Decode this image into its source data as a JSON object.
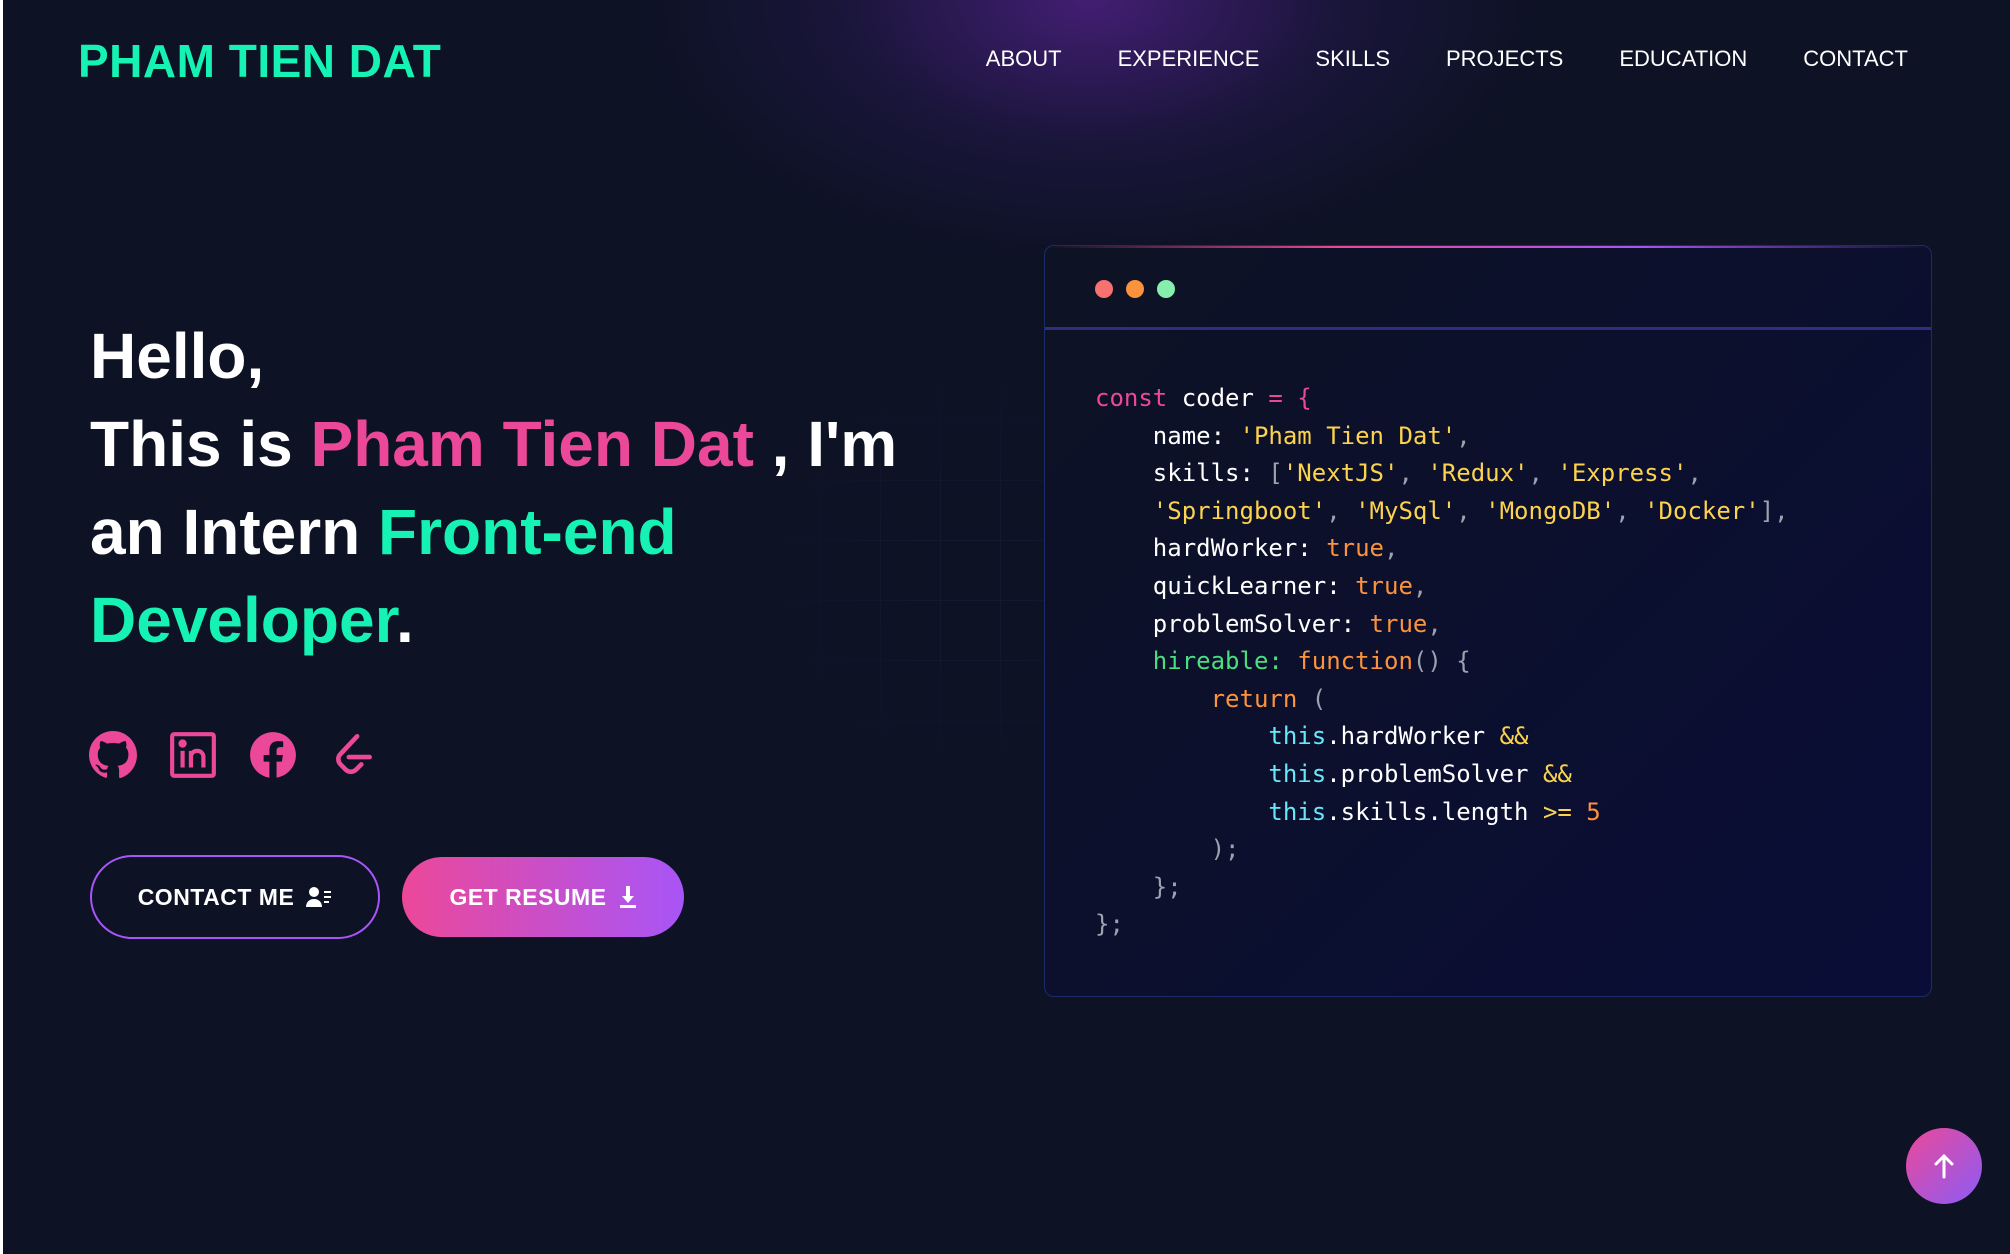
{
  "header": {
    "logo": "PHAM TIEN DAT",
    "nav": [
      "ABOUT",
      "EXPERIENCE",
      "SKILLS",
      "PROJECTS",
      "EDUCATION",
      "CONTACT"
    ]
  },
  "hero": {
    "line1": "Hello,",
    "this_is": "This is ",
    "name": "Pham Tien Dat",
    "im": " , I'm",
    "an_intern": "an Intern ",
    "role1": "Front-end",
    "role2": "Developer",
    "period": "."
  },
  "socials": [
    "github-icon",
    "linkedin-icon",
    "facebook-icon",
    "leetcode-icon"
  ],
  "buttons": {
    "contact": "CONTACT ME",
    "resume": "GET RESUME"
  },
  "code": {
    "l1_kw": "const",
    "l1_var": " coder ",
    "l1_op": "= {",
    "name_key": "name: ",
    "name_val": "'Pham Tien Dat'",
    "skills_key": "skills: ",
    "skills_1": "'NextJS'",
    "skills_2": "'Redux'",
    "skills_3": "'Express'",
    "skills_4": "'Springboot'",
    "skills_5": "'MySql'",
    "skills_6": "'MongoDB'",
    "skills_7": "'Docker'",
    "hw_key": "hardWorker: ",
    "ql_key": "quickLearner: ",
    "ps_key": "problemSolver: ",
    "true_val": "true",
    "hire_key": "hireable: ",
    "hire_fn": "function",
    "hire_rest": "() {",
    "ret_kw": "return",
    "ret_paren": " (",
    "this_kw": "this",
    "c1": ".hardWorker ",
    "c2": ".problemSolver ",
    "c3": ".skills.length ",
    "and_op": "&&",
    "gte_op": ">=",
    "five": "5",
    "close1": ");",
    "close2": "};",
    "close3": "};"
  },
  "colors": {
    "accent_green": "#16f2b3",
    "accent_pink": "#ec4899",
    "accent_purple": "#a855f7",
    "background": "#0d1224"
  }
}
